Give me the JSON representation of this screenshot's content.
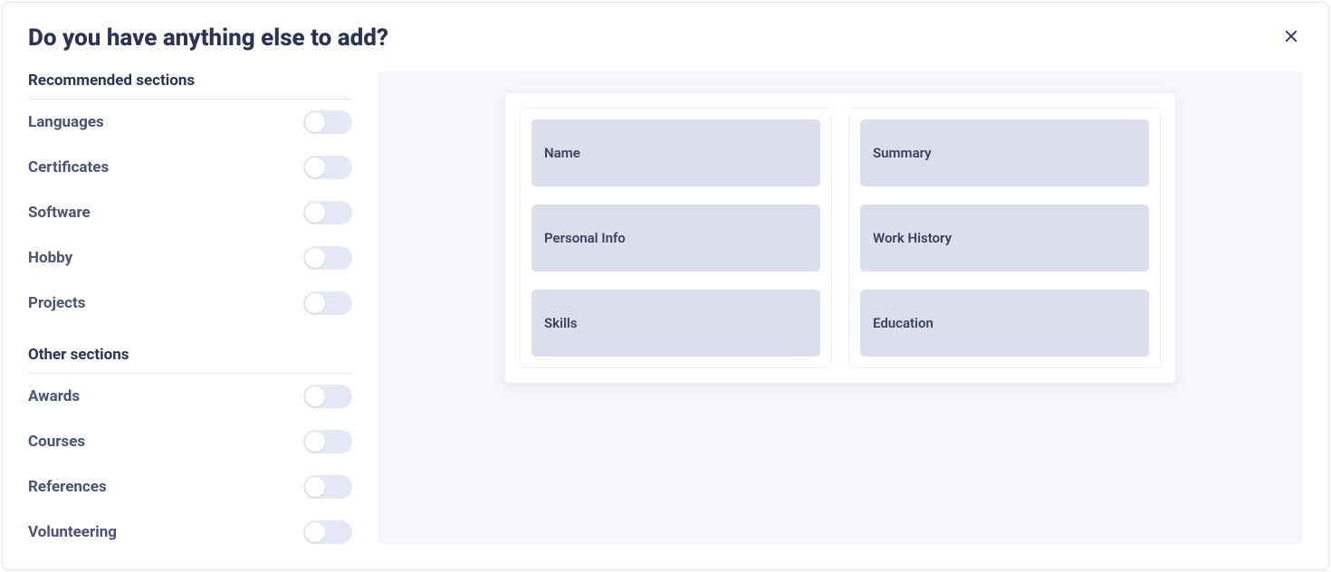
{
  "title": "Do you have anything else to add?",
  "groups": [
    {
      "title": "Recommended sections",
      "items": [
        {
          "label": "Languages",
          "on": false,
          "slug": "languages"
        },
        {
          "label": "Certificates",
          "on": false,
          "slug": "certificates"
        },
        {
          "label": "Software",
          "on": false,
          "slug": "software"
        },
        {
          "label": "Hobby",
          "on": false,
          "slug": "hobby"
        },
        {
          "label": "Projects",
          "on": false,
          "slug": "projects"
        }
      ]
    },
    {
      "title": "Other sections",
      "items": [
        {
          "label": "Awards",
          "on": false,
          "slug": "awards"
        },
        {
          "label": "Courses",
          "on": false,
          "slug": "courses"
        },
        {
          "label": "References",
          "on": false,
          "slug": "references"
        },
        {
          "label": "Volunteering",
          "on": false,
          "slug": "volunteering"
        }
      ]
    }
  ],
  "preview": {
    "left": [
      "Name",
      "Personal Info",
      "Skills"
    ],
    "right": [
      "Summary",
      "Work History",
      "Education"
    ]
  }
}
